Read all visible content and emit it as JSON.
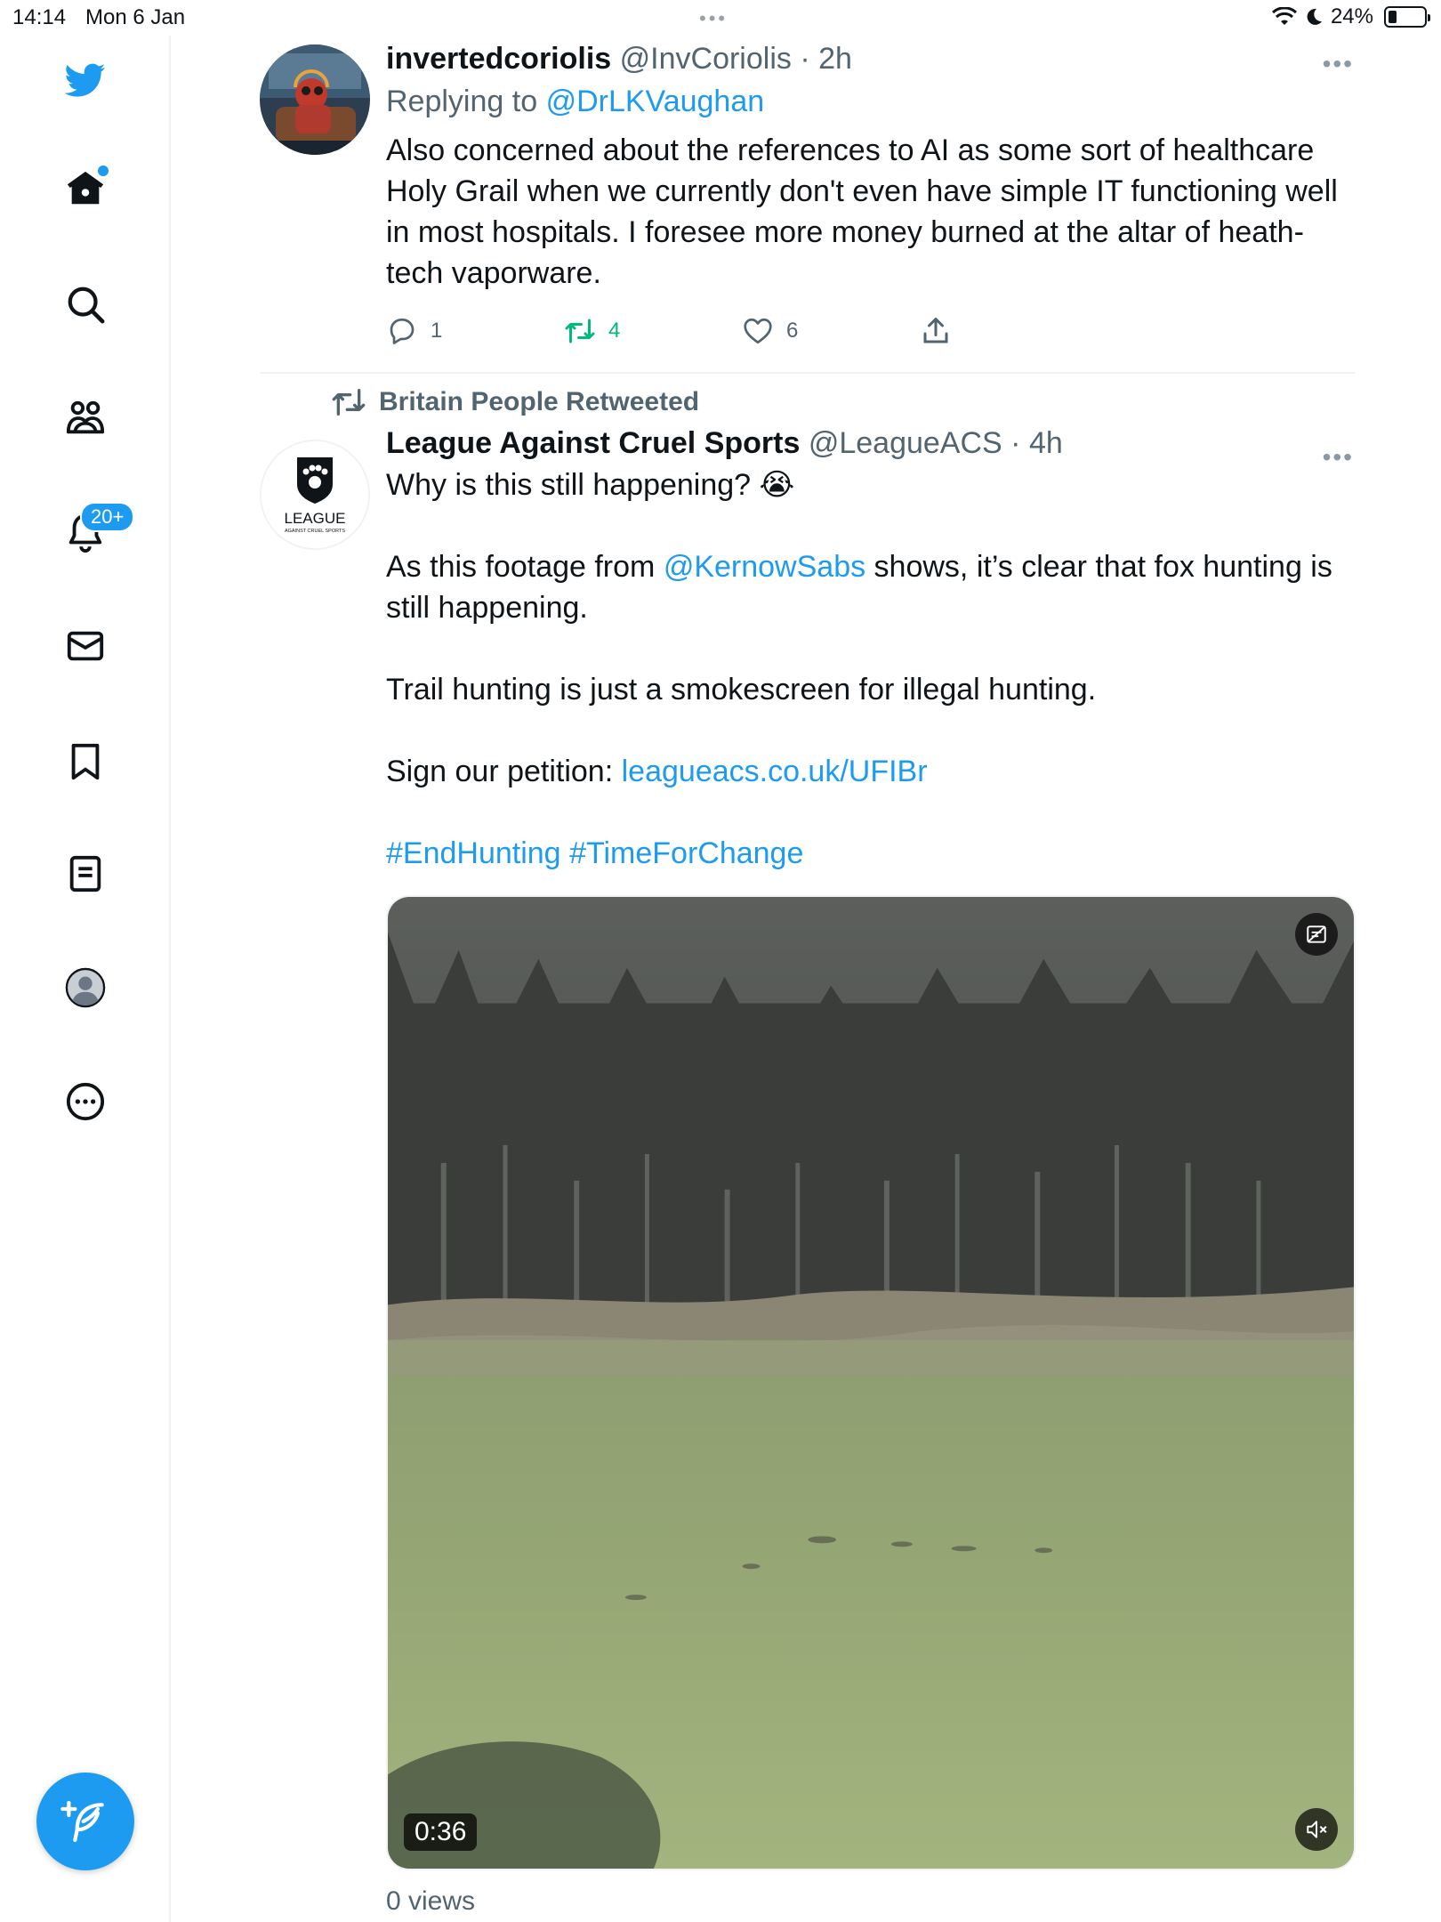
{
  "status_bar": {
    "time": "14:14",
    "date": "Mon 6 Jan",
    "battery_percent": "24%",
    "battery_level": 0.24
  },
  "sidebar": {
    "items": [
      {
        "name": "twitter-logo",
        "icon": "bird-icon"
      },
      {
        "name": "home",
        "icon": "home-icon",
        "has_dot": true
      },
      {
        "name": "explore",
        "icon": "search-icon"
      },
      {
        "name": "communities",
        "icon": "people-icon"
      },
      {
        "name": "notifications",
        "icon": "bell-icon",
        "badge": "20+"
      },
      {
        "name": "messages",
        "icon": "envelope-icon"
      },
      {
        "name": "bookmarks",
        "icon": "bookmark-icon"
      },
      {
        "name": "lists",
        "icon": "list-icon"
      },
      {
        "name": "profile",
        "icon": "avatar-icon"
      },
      {
        "name": "more",
        "icon": "more-circle-icon"
      }
    ],
    "compose_icon": "feather-plus-icon"
  },
  "tweets": [
    {
      "display_name": "invertedcoriolis",
      "handle": "@InvCoriolis",
      "time": "· 2h",
      "replying_prefix": "Replying to",
      "replying_to": "@DrLKVaughan",
      "text": "Also concerned about the references to AI as some sort of healthcare Holy Grail when we currently don't even have simple IT functioning well in most hospitals. I foresee more money burned at the altar of heath-tech vaporware.",
      "replies": "1",
      "retweets": "4",
      "likes": "6"
    },
    {
      "retweeted_by": "Britain People Retweeted",
      "display_name": "League Against Cruel Sports",
      "handle": "@LeagueACS",
      "time": "· 4h",
      "avatar_text": "LEAGUE",
      "avatar_subtext": "AGAINST CRUEL SPORTS",
      "p1": "Why is this still happening? 😭",
      "p2_pre": "As this footage from ",
      "p2_mention": "@KernowSabs",
      "p2_post": " shows, it’s clear that fox hunting is still happening.",
      "p3": "Trail hunting is just a smokescreen for illegal hunting.",
      "p4_pre": "Sign our petition: ",
      "p4_link": "leagueacs.co.uk/UFIBr",
      "hashtag1": "#EndHunting",
      "hashtag2": "#TimeForChange",
      "video_duration": "0:36",
      "views": "0 views"
    }
  ]
}
